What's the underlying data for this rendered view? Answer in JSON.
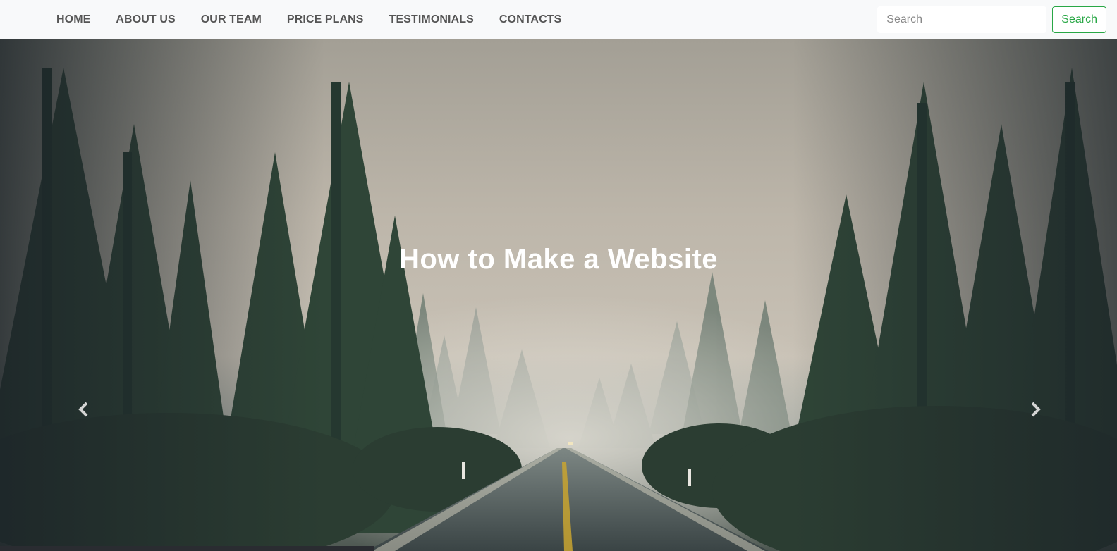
{
  "navbar": {
    "items": [
      {
        "label": "HOME"
      },
      {
        "label": "ABOUT US"
      },
      {
        "label": "OUR TEAM"
      },
      {
        "label": "PRICE PLANS"
      },
      {
        "label": "TESTIMONIALS"
      },
      {
        "label": "CONTACTS"
      }
    ],
    "search": {
      "placeholder": "Search",
      "button_label": "Search"
    }
  },
  "hero": {
    "caption": "How to Make a Website",
    "prev_icon": "chevron-left-icon",
    "next_icon": "chevron-right-icon"
  },
  "colors": {
    "navbar_bg": "#f8f9fa",
    "nav_text": "#555555",
    "search_accent": "#28a745",
    "caption_text": "#ffffff"
  }
}
